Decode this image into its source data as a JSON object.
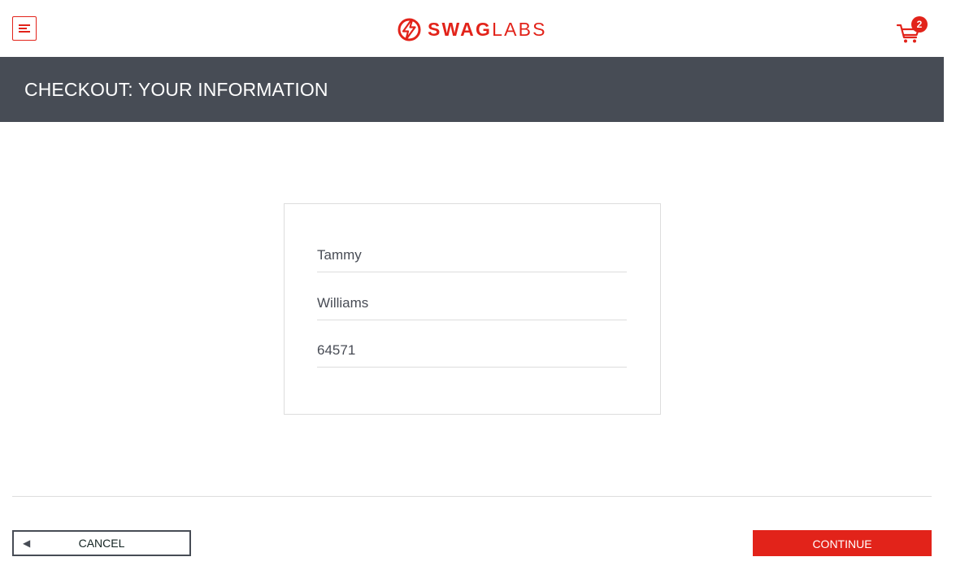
{
  "header": {
    "logo_bold": "SWAG",
    "logo_light": "LABS",
    "logo_icon": "bolt-circle-icon",
    "menu_icon": "hamburger-menu-icon",
    "cart_icon": "shopping-cart-icon",
    "cart_count": "2"
  },
  "page": {
    "title": "CHECKOUT: YOUR INFORMATION"
  },
  "form": {
    "first_name": {
      "value": "Tammy"
    },
    "last_name": {
      "value": "Williams"
    },
    "postal_code": {
      "value": "64571"
    }
  },
  "actions": {
    "cancel_label": "CANCEL",
    "cancel_icon": "left-arrow-icon",
    "continue_label": "CONTINUE"
  },
  "colors": {
    "brand_red": "#e2231a",
    "subheader_bg": "#474c55",
    "border": "#dddddd"
  }
}
